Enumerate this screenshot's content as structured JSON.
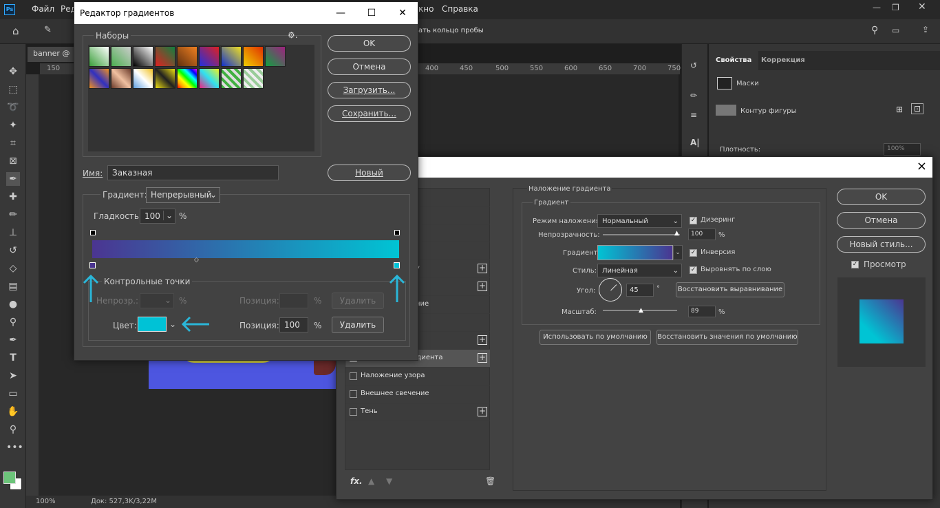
{
  "app": {
    "logo": "Ps",
    "menu": [
      "Файл",
      "Ред",
      "кно",
      "Справка"
    ],
    "options_text": "ать кольцо пробы",
    "doc_tab": "banner @",
    "ruler_ticks_top": [
      "150",
      "400",
      "450",
      "500",
      "550",
      "600",
      "650",
      "700",
      "750"
    ],
    "status_zoom": "100%",
    "status_doc": "Док: 527,3K/3,22M"
  },
  "props": {
    "tabs": [
      "Свойства",
      "Коррекция"
    ],
    "masks_label": "Маски",
    "shape_label": "Контур фигуры",
    "density_label": "Плотность:",
    "density_value": "100%"
  },
  "gradient_editor": {
    "title": "Редактор градиентов",
    "presets_label": "Наборы",
    "buttons": {
      "ok": "OK",
      "cancel": "Отмена",
      "load": "Загрузить...",
      "save": "Сохранить...",
      "new": "Новый"
    },
    "name_label": "Имя:",
    "name_value": "Заказная",
    "gradient_type_label": "Градиент:",
    "gradient_type_value": "Непрерывный",
    "smoothness_label": "Гладкость:",
    "smoothness_value": "100",
    "percent": "%",
    "stops_group_label": "Контрольные точки",
    "opacity_label": "Непрозр.:",
    "position_label": "Позиция:",
    "delete_label": "Удалить",
    "color_label": "Цвет:",
    "color_value": "#00c2d6",
    "color_position_value": "100",
    "gradient_start": "#4b3591",
    "gradient_end": "#00c4d4"
  },
  "layer_style": {
    "close_icon": "×",
    "list": [
      {
        "label": "",
        "checked": false,
        "plus": false
      },
      {
        "label": "",
        "checked": false,
        "plus": false
      },
      {
        "label": "",
        "checked": false,
        "plus": false
      },
      {
        "label": "",
        "checked": false,
        "plus": false
      },
      {
        "label": "у",
        "checked": false,
        "plus": true
      },
      {
        "label": "",
        "checked": false,
        "plus": true
      },
      {
        "label": "ние",
        "checked": false,
        "plus": false
      },
      {
        "label": "",
        "checked": false,
        "plus": false
      },
      {
        "label": "",
        "checked": false,
        "plus": true
      },
      {
        "label": "Наложение градиента",
        "checked": true,
        "plus": true
      },
      {
        "label": "Наложение узора",
        "checked": false,
        "plus": false
      },
      {
        "label": "Внешнее свечение",
        "checked": false,
        "plus": false
      },
      {
        "label": "Тень",
        "checked": false,
        "plus": true
      }
    ],
    "fx_label": "fx.",
    "section_title": "Наложение градиента",
    "group_title": "Градиент",
    "blend_mode_label": "Режим наложения:",
    "blend_mode_value": "Нормальный",
    "dither_label": "Дизеринг",
    "opacity_label": "Непрозрачность:",
    "opacity_value": "100",
    "gradient_label": "Градиент:",
    "reverse_label": "Инверсия",
    "style_label": "Стиль:",
    "style_value": "Линейная",
    "align_label": "Выровнять по слою",
    "angle_label": "Угол:",
    "angle_value": "45",
    "degree": "°",
    "reset_align": "Восстановить выравнивание",
    "scale_label": "Масштаб:",
    "scale_value": "89",
    "percent": "%",
    "make_default": "Использовать по умолчанию",
    "reset_default": "Восстановить значения по умолчанию",
    "ok": "OK",
    "cancel": "Отмена",
    "new_style": "Новый стиль...",
    "preview_label": "Просмотр"
  }
}
